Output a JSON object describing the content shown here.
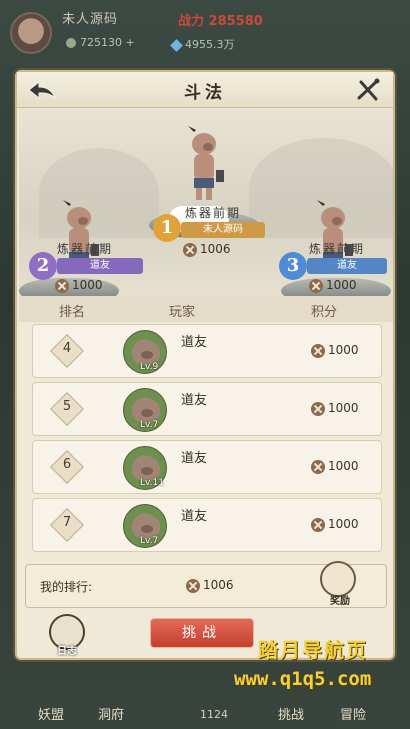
{
  "player": {
    "name": "未人源码",
    "power_label": "战力",
    "power_value": "285580",
    "currency1": "725130",
    "currency2": "4955.3万"
  },
  "panel": {
    "title": "斗法"
  },
  "podium": [
    {
      "rank": "1",
      "realm": "炼器前期",
      "name": "未人源码",
      "score": "1006",
      "badge_color": "#e0a33a",
      "ribbon_color": "#cf9a45"
    },
    {
      "rank": "2",
      "realm": "炼器前期",
      "name": "道友",
      "score": "1000",
      "badge_color": "#8f6fc4",
      "ribbon_color": "#8469bd"
    },
    {
      "rank": "3",
      "realm": "炼器前期",
      "name": "道友",
      "score": "1000",
      "badge_color": "#4f8bd6",
      "ribbon_color": "#5486c6"
    }
  ],
  "table": {
    "headers": {
      "rank": "排名",
      "player": "玩家",
      "score": "积分"
    },
    "rows": [
      {
        "rank": "4",
        "name": "道友",
        "level": "Lv.9",
        "score": "1000"
      },
      {
        "rank": "5",
        "name": "道友",
        "level": "Lv.7",
        "score": "1000"
      },
      {
        "rank": "6",
        "name": "道友",
        "level": "Lv.11",
        "score": "1000"
      },
      {
        "rank": "7",
        "name": "道友",
        "level": "Lv.7",
        "score": "1000"
      }
    ]
  },
  "my_rank": {
    "label": "我的排行:",
    "score": "1006"
  },
  "buttons": {
    "reward": "奖励",
    "challenge": "挑战",
    "log": "日志"
  },
  "bottom_nav": {
    "item1": "妖盟",
    "item2": "洞府",
    "item3": "挑战",
    "item4": "冒险",
    "number": "1124"
  },
  "watermark": {
    "line1": "踏月导航页",
    "line2": "www.q1q5.com"
  }
}
